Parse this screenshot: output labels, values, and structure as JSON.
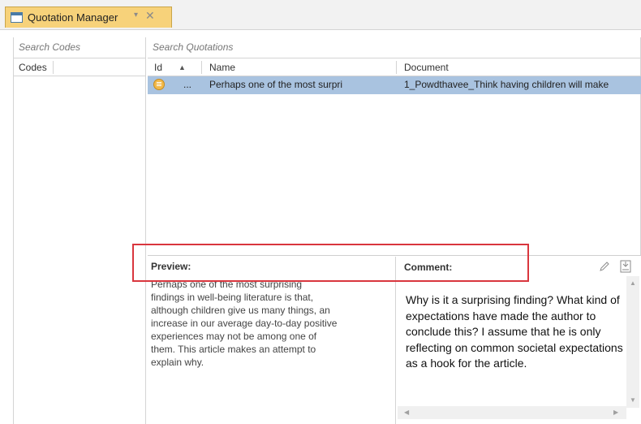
{
  "tab": {
    "label": "Quotation Manager",
    "pin_glyph": "▾",
    "close_glyph": "✕"
  },
  "codes_panel": {
    "search_placeholder": "Search Codes",
    "column_header": "Codes"
  },
  "quotations_panel": {
    "search_placeholder": "Search Quotations",
    "columns": [
      "Id",
      "Name",
      "Document"
    ],
    "sort_indicator": "▲",
    "rows": [
      {
        "id": "...",
        "name": "Perhaps one of the most surpri",
        "document": "1_Powdthavee_Think having children will make"
      }
    ]
  },
  "preview": {
    "title": "Preview:",
    "text": "Perhaps one of the most surprising findings in well-being literature is that, although children give us many things, an increase in our average day-to-day positive experiences may not be among one of them. This article makes an attempt to explain why."
  },
  "comment": {
    "title": "Comment:",
    "text": "Why is it a surprising finding? What kind of expectations have made the author to conclude this? I assume that he is only reflecting on common societal expectations as a hook for the article."
  },
  "colors": {
    "tab_active": "#f7d27a",
    "selected_row": "#a9c3e0",
    "highlight_box": "#d9363e"
  }
}
